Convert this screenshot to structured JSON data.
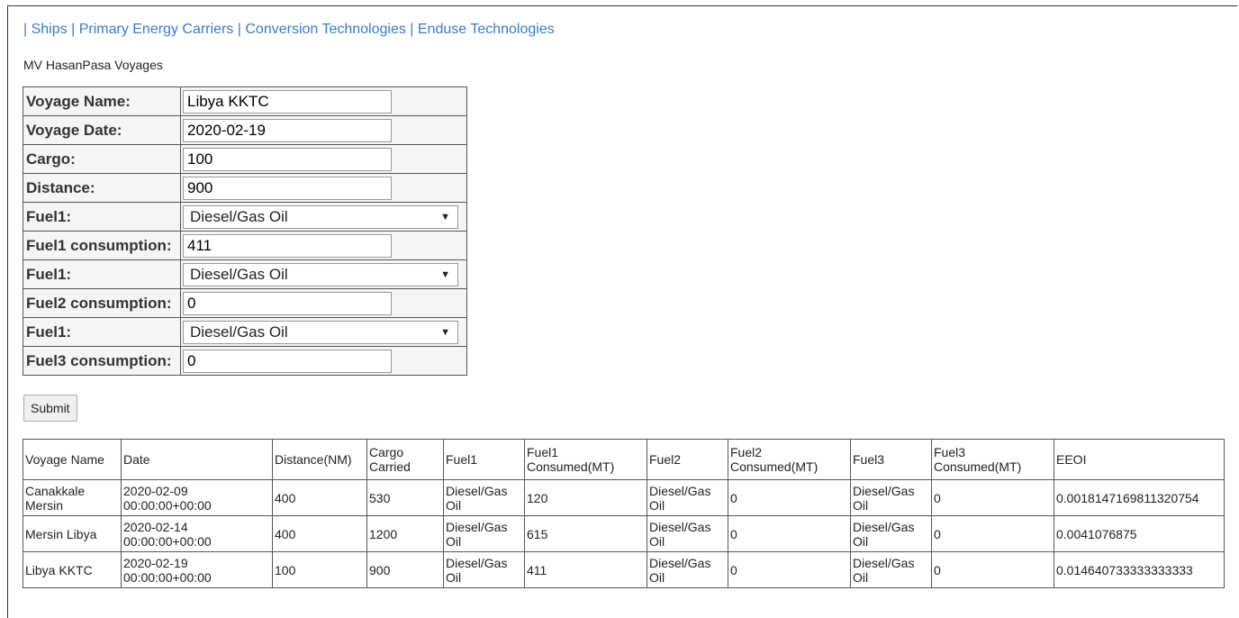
{
  "nav": {
    "sep": "|",
    "links": [
      "Ships",
      "Primary Energy Carriers",
      "Conversion Technologies",
      "Enduse Technologies"
    ]
  },
  "page_title": "MV HasanPasa Voyages",
  "form": {
    "voyage_name": {
      "label": "Voyage Name:",
      "value": "Libya KKTC"
    },
    "voyage_date": {
      "label": "Voyage Date:",
      "value": "2020-02-19"
    },
    "cargo": {
      "label": "Cargo:",
      "value": "100"
    },
    "distance": {
      "label": "Distance:",
      "value": "900"
    },
    "fuel1": {
      "label": "Fuel1:",
      "value": "Diesel/Gas Oil"
    },
    "fuel1_consumption": {
      "label": "Fuel1 consumption:",
      "value": "411"
    },
    "fuel2": {
      "label": "Fuel1:",
      "value": "Diesel/Gas Oil"
    },
    "fuel2_consumption": {
      "label": "Fuel2 consumption:",
      "value": "0"
    },
    "fuel3": {
      "label": "Fuel1:",
      "value": "Diesel/Gas Oil"
    },
    "fuel3_consumption": {
      "label": "Fuel3 consumption:",
      "value": "0"
    },
    "submit_label": "Submit"
  },
  "table": {
    "headers": [
      "Voyage Name",
      "Date",
      "Distance(NM)",
      "Cargo Carried",
      "Fuel1",
      "Fuel1 Consumed(MT)",
      "Fuel2",
      "Fuel2 Consumed(MT)",
      "Fuel3",
      "Fuel3 Consumed(MT)",
      "EEOI"
    ],
    "rows": [
      [
        "Canakkale Mersin",
        "2020-02-09 00:00:00+00:00",
        "400",
        "530",
        "Diesel/Gas Oil",
        "120",
        "Diesel/Gas Oil",
        "0",
        "Diesel/Gas Oil",
        "0",
        "0.0018147169811320754"
      ],
      [
        "Mersin Libya",
        "2020-02-14 00:00:00+00:00",
        "400",
        "1200",
        "Diesel/Gas Oil",
        "615",
        "Diesel/Gas Oil",
        "0",
        "Diesel/Gas Oil",
        "0",
        "0.0041076875"
      ],
      [
        "Libya KKTC",
        "2020-02-19 00:00:00+00:00",
        "100",
        "900",
        "Diesel/Gas Oil",
        "411",
        "Diesel/Gas Oil",
        "0",
        "Diesel/Gas Oil",
        "0",
        "0.014640733333333333"
      ]
    ]
  }
}
